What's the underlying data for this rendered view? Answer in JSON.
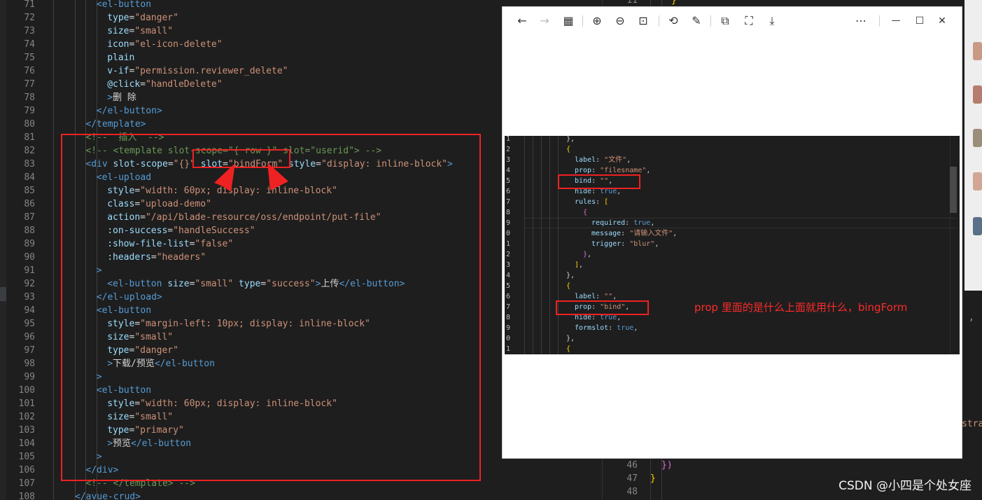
{
  "left_editor": {
    "lines": [
      {
        "n": "71",
        "indent": 4,
        "parts": [
          [
            "t-tag",
            "<el-button"
          ]
        ]
      },
      {
        "n": "72",
        "indent": 5,
        "parts": [
          [
            "t-attr",
            "type"
          ],
          [
            "t-txt",
            "="
          ],
          [
            "t-str",
            "\"danger\""
          ]
        ]
      },
      {
        "n": "73",
        "indent": 5,
        "parts": [
          [
            "t-attr",
            "size"
          ],
          [
            "t-txt",
            "="
          ],
          [
            "t-str",
            "\"small\""
          ]
        ]
      },
      {
        "n": "74",
        "indent": 5,
        "parts": [
          [
            "t-attr",
            "icon"
          ],
          [
            "t-txt",
            "="
          ],
          [
            "t-str",
            "\"el-icon-delete\""
          ]
        ]
      },
      {
        "n": "75",
        "indent": 5,
        "parts": [
          [
            "t-attr",
            "plain"
          ]
        ]
      },
      {
        "n": "76",
        "indent": 5,
        "parts": [
          [
            "t-attr",
            "v-if"
          ],
          [
            "t-txt",
            "="
          ],
          [
            "t-str",
            "\"permission.reviewer_delete\""
          ]
        ]
      },
      {
        "n": "77",
        "indent": 5,
        "parts": [
          [
            "t-attr",
            "@click"
          ],
          [
            "t-txt",
            "="
          ],
          [
            "t-str",
            "\"handleDelete\""
          ]
        ]
      },
      {
        "n": "78",
        "indent": 5,
        "parts": [
          [
            "t-tag",
            ">"
          ],
          [
            "t-txt",
            "删 除"
          ]
        ]
      },
      {
        "n": "79",
        "indent": 4,
        "parts": [
          [
            "t-tag",
            "</el-button>"
          ]
        ]
      },
      {
        "n": "80",
        "indent": 3,
        "parts": [
          [
            "t-tag",
            "</template>"
          ]
        ]
      },
      {
        "n": "81",
        "indent": 3,
        "parts": [
          [
            "t-com",
            "<!--  插入  -->"
          ]
        ]
      },
      {
        "n": "82",
        "indent": 3,
        "parts": [
          [
            "t-com",
            "<!-- <template slot-scope=\"{ row }\" slot=\"userid\"> -->"
          ]
        ]
      },
      {
        "n": "83",
        "indent": 3,
        "parts": [
          [
            "t-tag",
            "<div "
          ],
          [
            "t-attr",
            "slot-scope"
          ],
          [
            "t-txt",
            "="
          ],
          [
            "t-str",
            "\"{}\""
          ],
          [
            "t-txt",
            " "
          ],
          [
            "t-attr",
            "slot"
          ],
          [
            "t-txt",
            "="
          ],
          [
            "t-str",
            "\"bindForm\""
          ],
          [
            "t-txt",
            " "
          ],
          [
            "t-attr",
            "style"
          ],
          [
            "t-txt",
            "="
          ],
          [
            "t-str",
            "\"display: inline-block\""
          ],
          [
            "t-tag",
            ">"
          ]
        ]
      },
      {
        "n": "84",
        "indent": 4,
        "parts": [
          [
            "t-tag",
            "<el-upload"
          ]
        ]
      },
      {
        "n": "85",
        "indent": 5,
        "parts": [
          [
            "t-attr",
            "style"
          ],
          [
            "t-txt",
            "="
          ],
          [
            "t-str",
            "\"width: 60px; display: inline-block\""
          ]
        ]
      },
      {
        "n": "86",
        "indent": 5,
        "parts": [
          [
            "t-attr",
            "class"
          ],
          [
            "t-txt",
            "="
          ],
          [
            "t-str",
            "\"upload-demo\""
          ]
        ]
      },
      {
        "n": "87",
        "indent": 5,
        "parts": [
          [
            "t-attr",
            "action"
          ],
          [
            "t-txt",
            "="
          ],
          [
            "t-str",
            "\"/api/blade-resource/oss/endpoint/put-file\""
          ]
        ]
      },
      {
        "n": "88",
        "indent": 5,
        "parts": [
          [
            "t-attr",
            ":on-success"
          ],
          [
            "t-txt",
            "="
          ],
          [
            "t-str",
            "\"handleSuccess\""
          ]
        ]
      },
      {
        "n": "89",
        "indent": 5,
        "parts": [
          [
            "t-attr",
            ":show-file-list"
          ],
          [
            "t-txt",
            "="
          ],
          [
            "t-str",
            "\"false\""
          ]
        ]
      },
      {
        "n": "90",
        "indent": 5,
        "parts": [
          [
            "t-attr",
            ":headers"
          ],
          [
            "t-txt",
            "="
          ],
          [
            "t-str",
            "\"headers\""
          ]
        ]
      },
      {
        "n": "91",
        "indent": 4,
        "parts": [
          [
            "t-tag",
            ">"
          ]
        ]
      },
      {
        "n": "92",
        "indent": 5,
        "parts": [
          [
            "t-tag",
            "<el-button "
          ],
          [
            "t-attr",
            "size"
          ],
          [
            "t-txt",
            "="
          ],
          [
            "t-str",
            "\"small\""
          ],
          [
            "t-txt",
            " "
          ],
          [
            "t-attr",
            "type"
          ],
          [
            "t-txt",
            "="
          ],
          [
            "t-str",
            "\"success\""
          ],
          [
            "t-tag",
            ">"
          ],
          [
            "t-txt",
            "上传"
          ],
          [
            "t-tag",
            "</el-button>"
          ]
        ]
      },
      {
        "n": "93",
        "indent": 4,
        "parts": [
          [
            "t-tag",
            "</el-upload>"
          ]
        ]
      },
      {
        "n": "94",
        "indent": 4,
        "parts": [
          [
            "t-tag",
            "<el-button"
          ]
        ]
      },
      {
        "n": "95",
        "indent": 5,
        "parts": [
          [
            "t-attr",
            "style"
          ],
          [
            "t-txt",
            "="
          ],
          [
            "t-str",
            "\"margin-left: 10px; display: inline-block\""
          ]
        ]
      },
      {
        "n": "96",
        "indent": 5,
        "parts": [
          [
            "t-attr",
            "size"
          ],
          [
            "t-txt",
            "="
          ],
          [
            "t-str",
            "\"small\""
          ]
        ]
      },
      {
        "n": "97",
        "indent": 5,
        "parts": [
          [
            "t-attr",
            "type"
          ],
          [
            "t-txt",
            "="
          ],
          [
            "t-str",
            "\"danger\""
          ]
        ]
      },
      {
        "n": "98",
        "indent": 5,
        "parts": [
          [
            "t-tag",
            ">"
          ],
          [
            "t-txt",
            "下载/预览"
          ],
          [
            "t-tag",
            "</el-button"
          ]
        ]
      },
      {
        "n": "99",
        "indent": 4,
        "parts": [
          [
            "t-tag",
            ">"
          ]
        ]
      },
      {
        "n": "100",
        "indent": 4,
        "parts": [
          [
            "t-tag",
            "<el-button"
          ]
        ]
      },
      {
        "n": "101",
        "indent": 5,
        "parts": [
          [
            "t-attr",
            "style"
          ],
          [
            "t-txt",
            "="
          ],
          [
            "t-str",
            "\"width: 60px; display: inline-block\""
          ]
        ]
      },
      {
        "n": "102",
        "indent": 5,
        "parts": [
          [
            "t-attr",
            "size"
          ],
          [
            "t-txt",
            "="
          ],
          [
            "t-str",
            "\"small\""
          ]
        ]
      },
      {
        "n": "103",
        "indent": 5,
        "parts": [
          [
            "t-attr",
            "type"
          ],
          [
            "t-txt",
            "="
          ],
          [
            "t-str",
            "\"primary\""
          ]
        ]
      },
      {
        "n": "104",
        "indent": 5,
        "parts": [
          [
            "t-tag",
            ">"
          ],
          [
            "t-txt",
            "预览"
          ],
          [
            "t-tag",
            "</el-button"
          ]
        ]
      },
      {
        "n": "105",
        "indent": 4,
        "parts": [
          [
            "t-tag",
            ">"
          ]
        ]
      },
      {
        "n": "106",
        "indent": 3,
        "parts": [
          [
            "t-tag",
            "</div>"
          ]
        ]
      },
      {
        "n": "107",
        "indent": 3,
        "parts": [
          [
            "t-com",
            "<!-- </template> -->"
          ]
        ]
      },
      {
        "n": "108",
        "indent": 2,
        "parts": [
          [
            "t-tag",
            "</avue-crud>"
          ]
        ]
      }
    ]
  },
  "right_editor": {
    "lines": [
      {
        "n": "11",
        "text": "}",
        "cls": "t-brace"
      },
      {
        "n": "46",
        "text": "})",
        "cls": "t-paren"
      },
      {
        "n": "47",
        "text": "}",
        "cls": "t-brace"
      },
      {
        "n": "48",
        "text": "",
        "cls": "t-txt"
      }
    ],
    "fragments": [
      ",",
      "stra"
    ]
  },
  "viewer": {
    "toolbar": {
      "back": "←",
      "forward": "→",
      "thumbnails": "▦",
      "zoom_in": "⊕",
      "zoom_out": "⊖",
      "actual_size": "⊡",
      "rotate": "⟲",
      "edit": "✎",
      "copy": "⧉",
      "crop": "⛶",
      "save": "⤓",
      "more": "⋯",
      "minimize": "—",
      "maximize": "☐",
      "close": "✕"
    },
    "image": {
      "line_numbers": [
        "1",
        "2",
        "3",
        "4",
        "5",
        "6",
        "7",
        "8",
        "9",
        "0",
        "1",
        "2",
        "3",
        "4",
        "5",
        "6",
        "7",
        "8",
        "9",
        "0",
        "1"
      ],
      "lines": [
        {
          "indent": 6,
          "parts": [
            [
              "t-txt",
              "},"
            ]
          ]
        },
        {
          "indent": 6,
          "parts": [
            [
              "t-brace",
              "{"
            ]
          ]
        },
        {
          "indent": 7,
          "parts": [
            [
              "t-attr",
              "label"
            ],
            [
              "t-txt",
              ": "
            ],
            [
              "t-str",
              "\"文件\""
            ],
            [
              "t-txt",
              ","
            ]
          ]
        },
        {
          "indent": 7,
          "parts": [
            [
              "t-attr",
              "prop"
            ],
            [
              "t-txt",
              ": "
            ],
            [
              "t-str",
              "\"filesname\""
            ],
            [
              "t-txt",
              ","
            ]
          ]
        },
        {
          "indent": 7,
          "parts": [
            [
              "t-attr",
              "bind"
            ],
            [
              "t-txt",
              ": "
            ],
            [
              "t-str",
              "\"\""
            ],
            [
              "t-txt",
              ","
            ]
          ]
        },
        {
          "indent": 7,
          "parts": [
            [
              "t-attr",
              "hide"
            ],
            [
              "t-txt",
              ": "
            ],
            [
              "t-kw",
              "true"
            ],
            [
              "t-txt",
              ","
            ]
          ]
        },
        {
          "indent": 7,
          "parts": [
            [
              "t-attr",
              "rules"
            ],
            [
              "t-txt",
              ": "
            ],
            [
              "t-brace",
              "["
            ]
          ]
        },
        {
          "indent": 8,
          "parts": [
            [
              "t-paren",
              "{"
            ]
          ]
        },
        {
          "indent": 9,
          "parts": [
            [
              "t-attr",
              "required"
            ],
            [
              "t-txt",
              ": "
            ],
            [
              "t-kw",
              "true"
            ],
            [
              "t-txt",
              ","
            ]
          ]
        },
        {
          "indent": 9,
          "parts": [
            [
              "t-attr",
              "message"
            ],
            [
              "t-txt",
              ": "
            ],
            [
              "t-str",
              "\"请输入文件\""
            ],
            [
              "t-txt",
              ","
            ]
          ]
        },
        {
          "indent": 9,
          "parts": [
            [
              "t-attr",
              "trigger"
            ],
            [
              "t-txt",
              ": "
            ],
            [
              "t-str",
              "\"blur\""
            ],
            [
              "t-txt",
              ","
            ]
          ]
        },
        {
          "indent": 8,
          "parts": [
            [
              "t-paren",
              "}"
            ],
            [
              "t-txt",
              ","
            ]
          ]
        },
        {
          "indent": 7,
          "parts": [
            [
              "t-brace",
              "]"
            ],
            [
              "t-txt",
              ","
            ]
          ]
        },
        {
          "indent": 6,
          "parts": [
            [
              "t-txt",
              "},"
            ]
          ]
        },
        {
          "indent": 6,
          "parts": [
            [
              "t-brace",
              "{"
            ]
          ]
        },
        {
          "indent": 7,
          "parts": [
            [
              "t-attr",
              "label"
            ],
            [
              "t-txt",
              ": "
            ],
            [
              "t-str",
              "\"\""
            ],
            [
              "t-txt",
              ","
            ]
          ]
        },
        {
          "indent": 7,
          "parts": [
            [
              "t-attr",
              "prop"
            ],
            [
              "t-txt",
              ": "
            ],
            [
              "t-str",
              "\"bind\""
            ],
            [
              "t-txt",
              ","
            ]
          ]
        },
        {
          "indent": 7,
          "parts": [
            [
              "t-attr",
              "hide"
            ],
            [
              "t-txt",
              ": "
            ],
            [
              "t-kw",
              "true"
            ],
            [
              "t-txt",
              ","
            ]
          ]
        },
        {
          "indent": 7,
          "parts": [
            [
              "t-attr",
              "formslot"
            ],
            [
              "t-txt",
              ": "
            ],
            [
              "t-kw",
              "true"
            ],
            [
              "t-txt",
              ","
            ]
          ]
        },
        {
          "indent": 6,
          "parts": [
            [
              "t-txt",
              "},"
            ]
          ]
        },
        {
          "indent": 6,
          "parts": [
            [
              "t-brace",
              "{"
            ]
          ]
        }
      ],
      "annotation": "prop 里面的是什么上面就用什么，bingForm"
    }
  },
  "watermark": "CSDN @小四是个处女座",
  "colors": {
    "annotation_red": "#ee2222",
    "editor_bg": "#1e1e1e"
  }
}
